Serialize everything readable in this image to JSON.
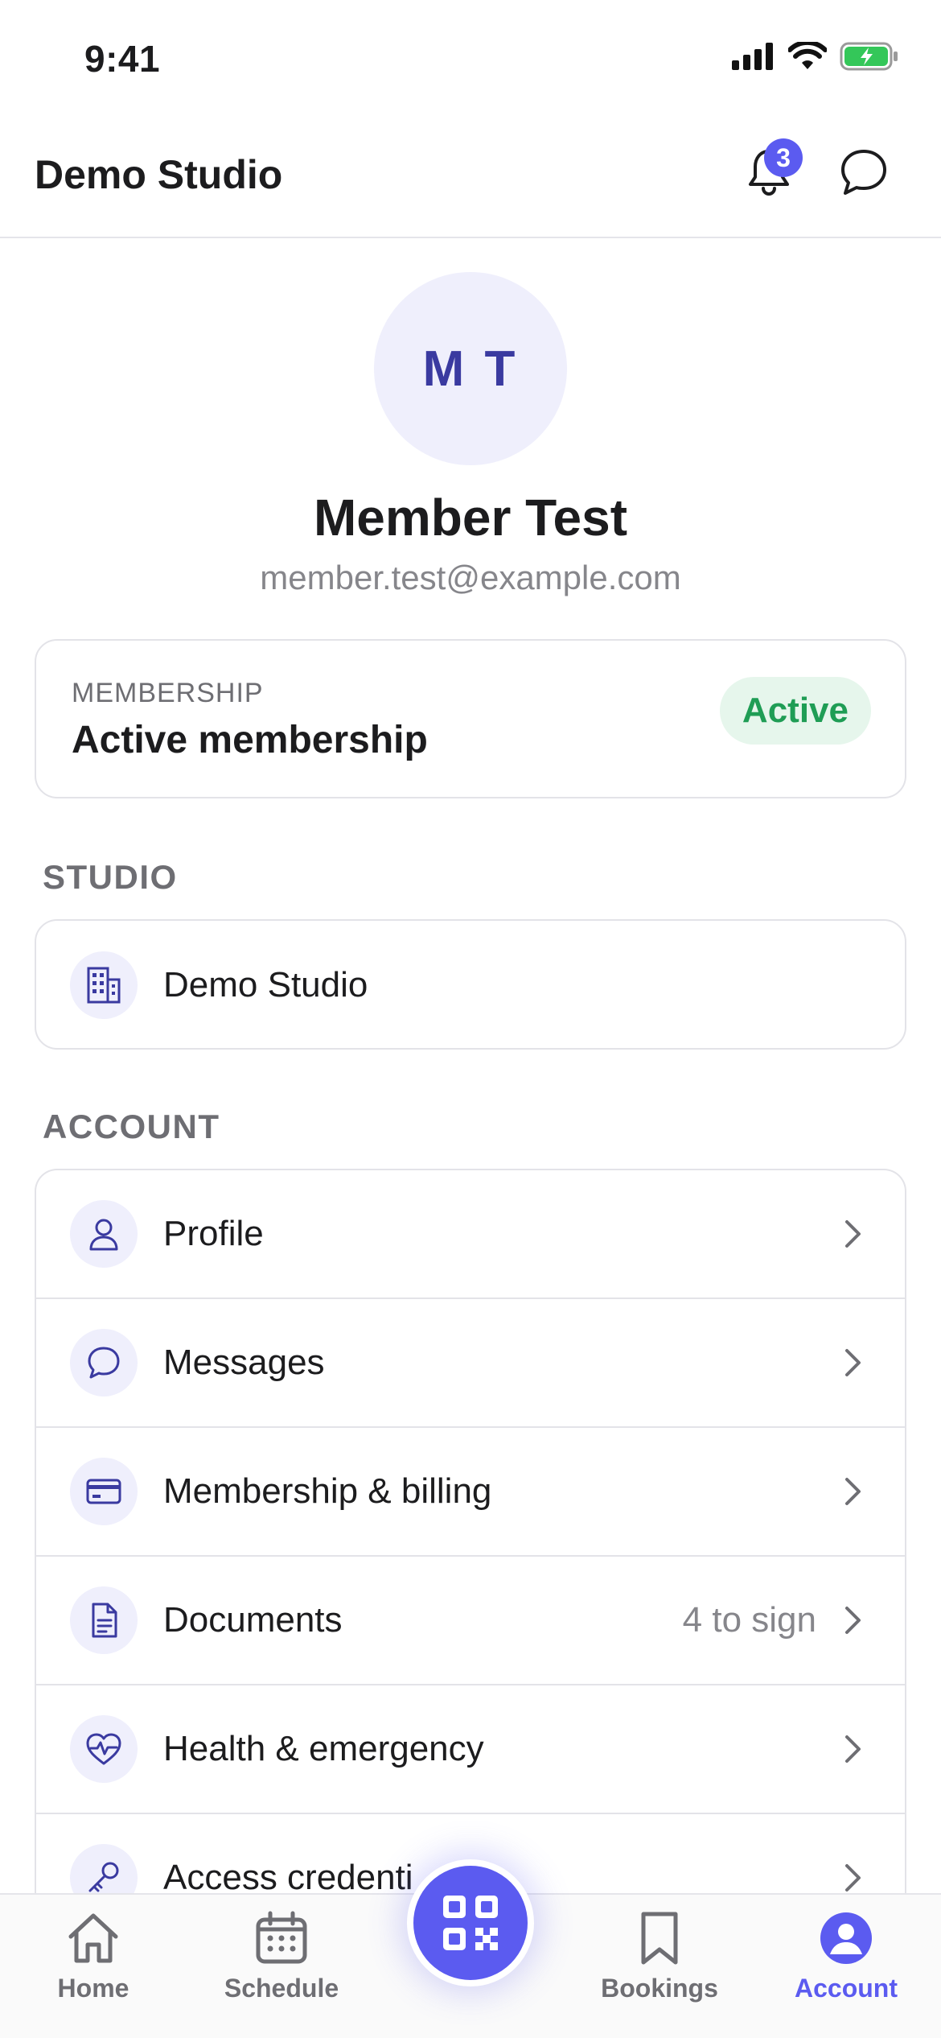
{
  "status_bar": {
    "time": "9:41"
  },
  "header": {
    "title": "Demo Studio",
    "notification_count": "3"
  },
  "profile": {
    "initials": "M T",
    "name": "Member Test",
    "email": "member.test@example.com"
  },
  "membership": {
    "kicker": "MEMBERSHIP",
    "title": "Active membership",
    "status": "Active"
  },
  "studio_section": {
    "label": "STUDIO",
    "studio_name": "Demo Studio"
  },
  "account_section": {
    "label": "ACCOUNT",
    "items": [
      {
        "label": "Profile",
        "meta": "",
        "icon": "person-icon"
      },
      {
        "label": "Messages",
        "meta": "",
        "icon": "chat-bubble-icon"
      },
      {
        "label": "Membership & billing",
        "meta": "",
        "icon": "credit-card-icon"
      },
      {
        "label": "Documents",
        "meta": "4 to sign",
        "icon": "document-icon"
      },
      {
        "label": "Health & emergency",
        "meta": "",
        "icon": "heart-pulse-icon"
      },
      {
        "label": "Access credenti",
        "meta": "",
        "icon": "key-icon"
      }
    ]
  },
  "bottom_nav": {
    "home": "Home",
    "schedule": "Schedule",
    "bookings": "Bookings",
    "account": "Account"
  },
  "colors": {
    "accent": "#5b5bf0",
    "active_green": "#1f9d55",
    "icon_bg": "#efeffc"
  }
}
